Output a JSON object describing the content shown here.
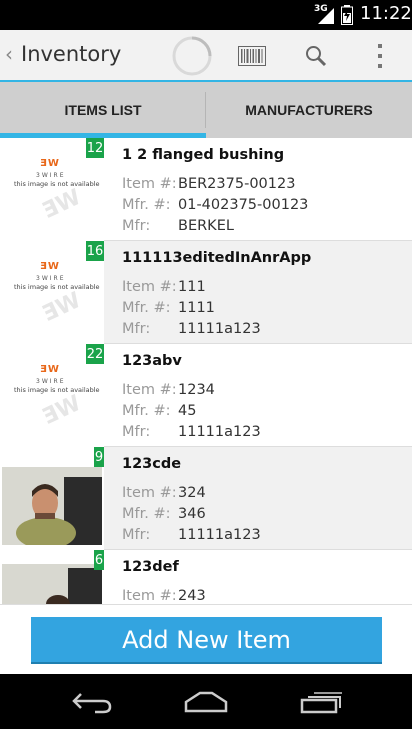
{
  "status_bar": {
    "network": "3G",
    "time": "11:22"
  },
  "action_bar": {
    "title": "Inventory"
  },
  "tabs": [
    {
      "label": "ITEMS LIST",
      "selected": true
    },
    {
      "label": "MANUFACTURERS",
      "selected": false
    }
  ],
  "labels": {
    "item": "Item #:",
    "mfr_number": "Mfr. #:",
    "mfr": "Mfr:"
  },
  "placeholder_image": {
    "brand": "3WIRE",
    "text": "this image is not available"
  },
  "items": [
    {
      "count": "12",
      "name": "1 2 flanged bushing",
      "item_number": "BER2375-00123",
      "mfr_number": "01-402375-00123",
      "mfr": "BERKEL"
    },
    {
      "count": "16",
      "name": "111113editedInAnrApp",
      "item_number": "111",
      "mfr_number": "1111",
      "mfr": "11111a123"
    },
    {
      "count": "22",
      "name": "123abv",
      "item_number": "1234",
      "mfr_number": "45",
      "mfr": "11111a123"
    },
    {
      "count": "9",
      "name": "123cde",
      "item_number": "324",
      "mfr_number": "346",
      "mfr": "11111a123"
    },
    {
      "count": "6",
      "name": "123def",
      "item_number": "243"
    }
  ],
  "add_button": {
    "label": "Add New Item"
  },
  "colors": {
    "accent": "#33b5e5",
    "button": "#33a4e0",
    "badge": "#1aa34a"
  }
}
